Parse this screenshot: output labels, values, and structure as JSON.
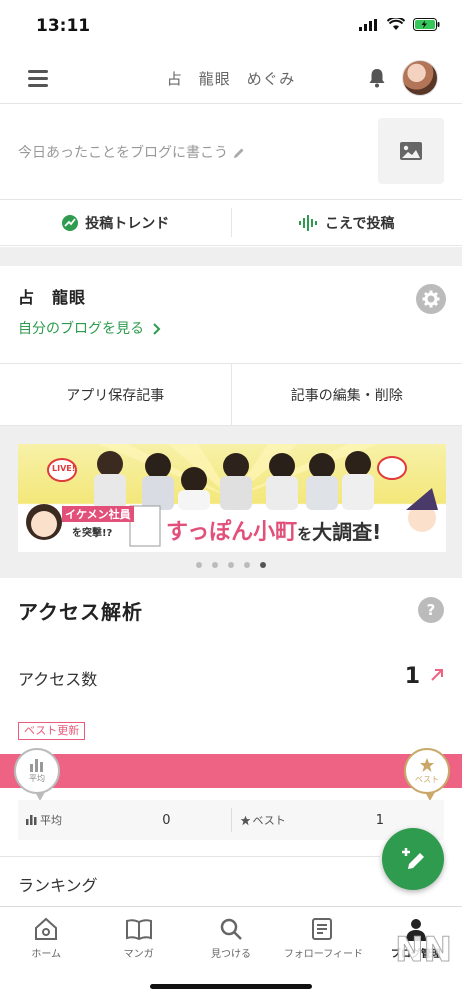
{
  "status_bar": {
    "time": "13:11"
  },
  "header": {
    "title": "占　龍眼　めぐみ"
  },
  "compose": {
    "placeholder": "今日あったことをブログに書こう"
  },
  "actions": {
    "trend_label": "投稿トレンド",
    "voice_label": "こえで投稿"
  },
  "blog": {
    "name": "占　龍眼",
    "view_link": "自分のブログを見る"
  },
  "row2": {
    "saved_label": "アプリ保存記事",
    "edit_label": "記事の編集・削除"
  },
  "banner": {
    "badge_text": "LIVE!",
    "sub_text_1": "イケメン社員",
    "sub_text_2": "を突撃!?",
    "headline_main": "すっぽん小町",
    "headline_mid": "を",
    "headline_end": "大調査!",
    "slide_count": 5,
    "active_slide": 5
  },
  "analytics": {
    "title": "アクセス解析",
    "access_label": "アクセス数",
    "access_value": "1",
    "best_update_badge": "ベスト更新",
    "avg_marker_label": "平均",
    "best_marker_label": "ベスト",
    "avg_label": "平均",
    "avg_value": "0",
    "best_label": "ベスト",
    "best_value": "1",
    "ranking_label": "ランキング"
  },
  "tabs": [
    {
      "label": "ホーム",
      "icon": "home-icon"
    },
    {
      "label": "マンガ",
      "icon": "book-icon"
    },
    {
      "label": "見つける",
      "icon": "search-icon"
    },
    {
      "label": "フォローフィード",
      "icon": "feed-icon"
    },
    {
      "label": "ブログ管理",
      "icon": "person-icon"
    }
  ],
  "watermark": "NN",
  "colors": {
    "accent_green": "#2e9b4e",
    "pink": "#ee6383",
    "gold": "#c9a86a"
  }
}
